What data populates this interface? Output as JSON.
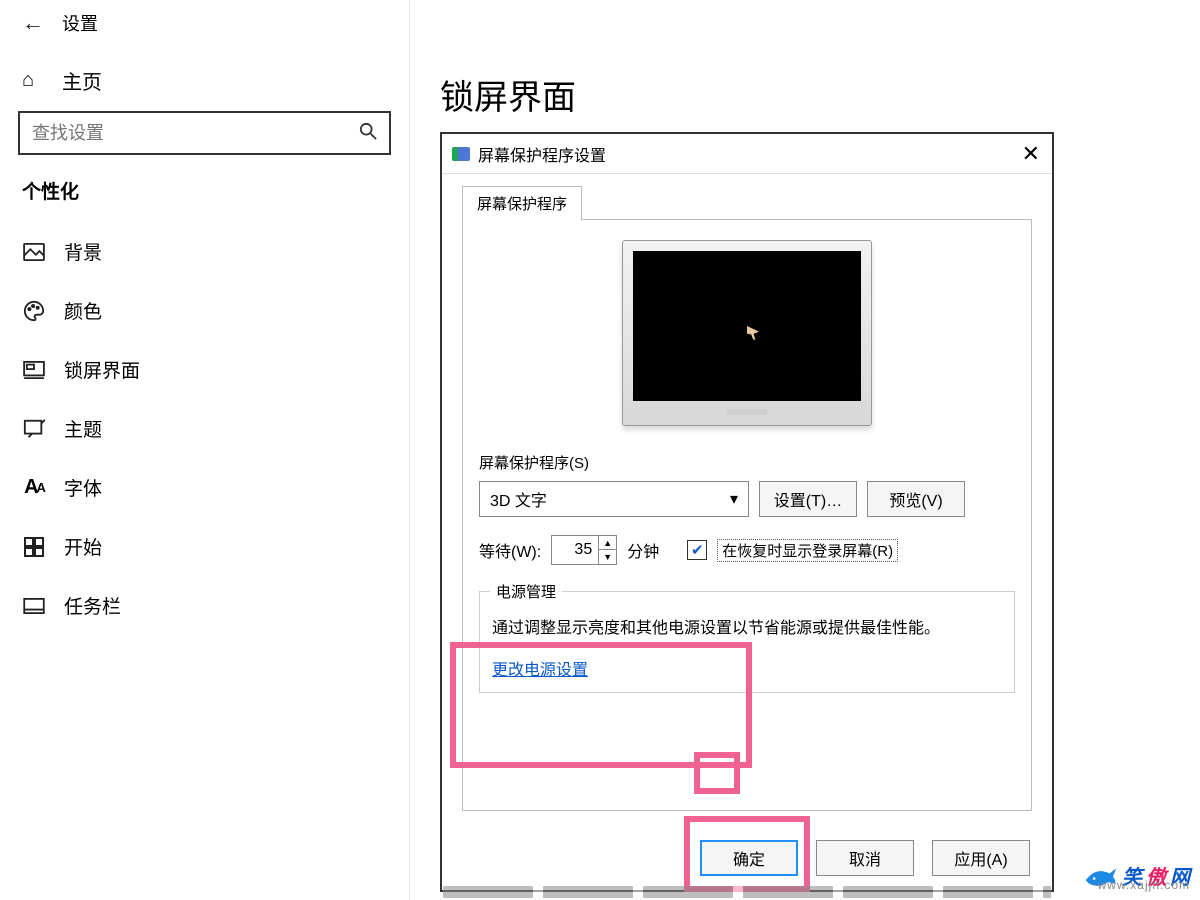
{
  "header": {
    "title": "设置"
  },
  "sidebar": {
    "home_label": "主页",
    "search_placeholder": "查找设置",
    "section_title": "个性化",
    "items": [
      {
        "label": "背景",
        "icon": "image-icon"
      },
      {
        "label": "颜色",
        "icon": "palette-icon"
      },
      {
        "label": "锁屏界面",
        "icon": "lockscreen-icon"
      },
      {
        "label": "主题",
        "icon": "theme-icon"
      },
      {
        "label": "字体",
        "icon": "font-icon"
      },
      {
        "label": "开始",
        "icon": "start-icon"
      },
      {
        "label": "任务栏",
        "icon": "taskbar-icon"
      }
    ]
  },
  "page": {
    "title": "锁屏界面"
  },
  "dialog": {
    "title": "屏幕保护程序设置",
    "tab_label": "屏幕保护程序",
    "saver_group_label": "屏幕保护程序(S)",
    "saver_selected": "3D 文字",
    "settings_btn": "设置(T)…",
    "preview_btn": "预览(V)",
    "wait_label": "等待(W):",
    "wait_value": "35",
    "minutes_label": "分钟",
    "resume_checkbox_checked": true,
    "resume_label": "在恢复时显示登录屏幕(R)",
    "power_group_label": "电源管理",
    "power_desc": "通过调整显示亮度和其他电源设置以节省能源或提供最佳性能。",
    "power_link": "更改电源设置",
    "ok_btn": "确定",
    "cancel_btn": "取消",
    "apply_btn": "应用(A)"
  },
  "watermark": {
    "char1": "笑",
    "char2": "傲",
    "char3": "网",
    "url": "www.xajjn.com"
  },
  "colors": {
    "highlight": "#f06292",
    "link": "#0a58ca",
    "primary_border": "#1e90ff"
  }
}
